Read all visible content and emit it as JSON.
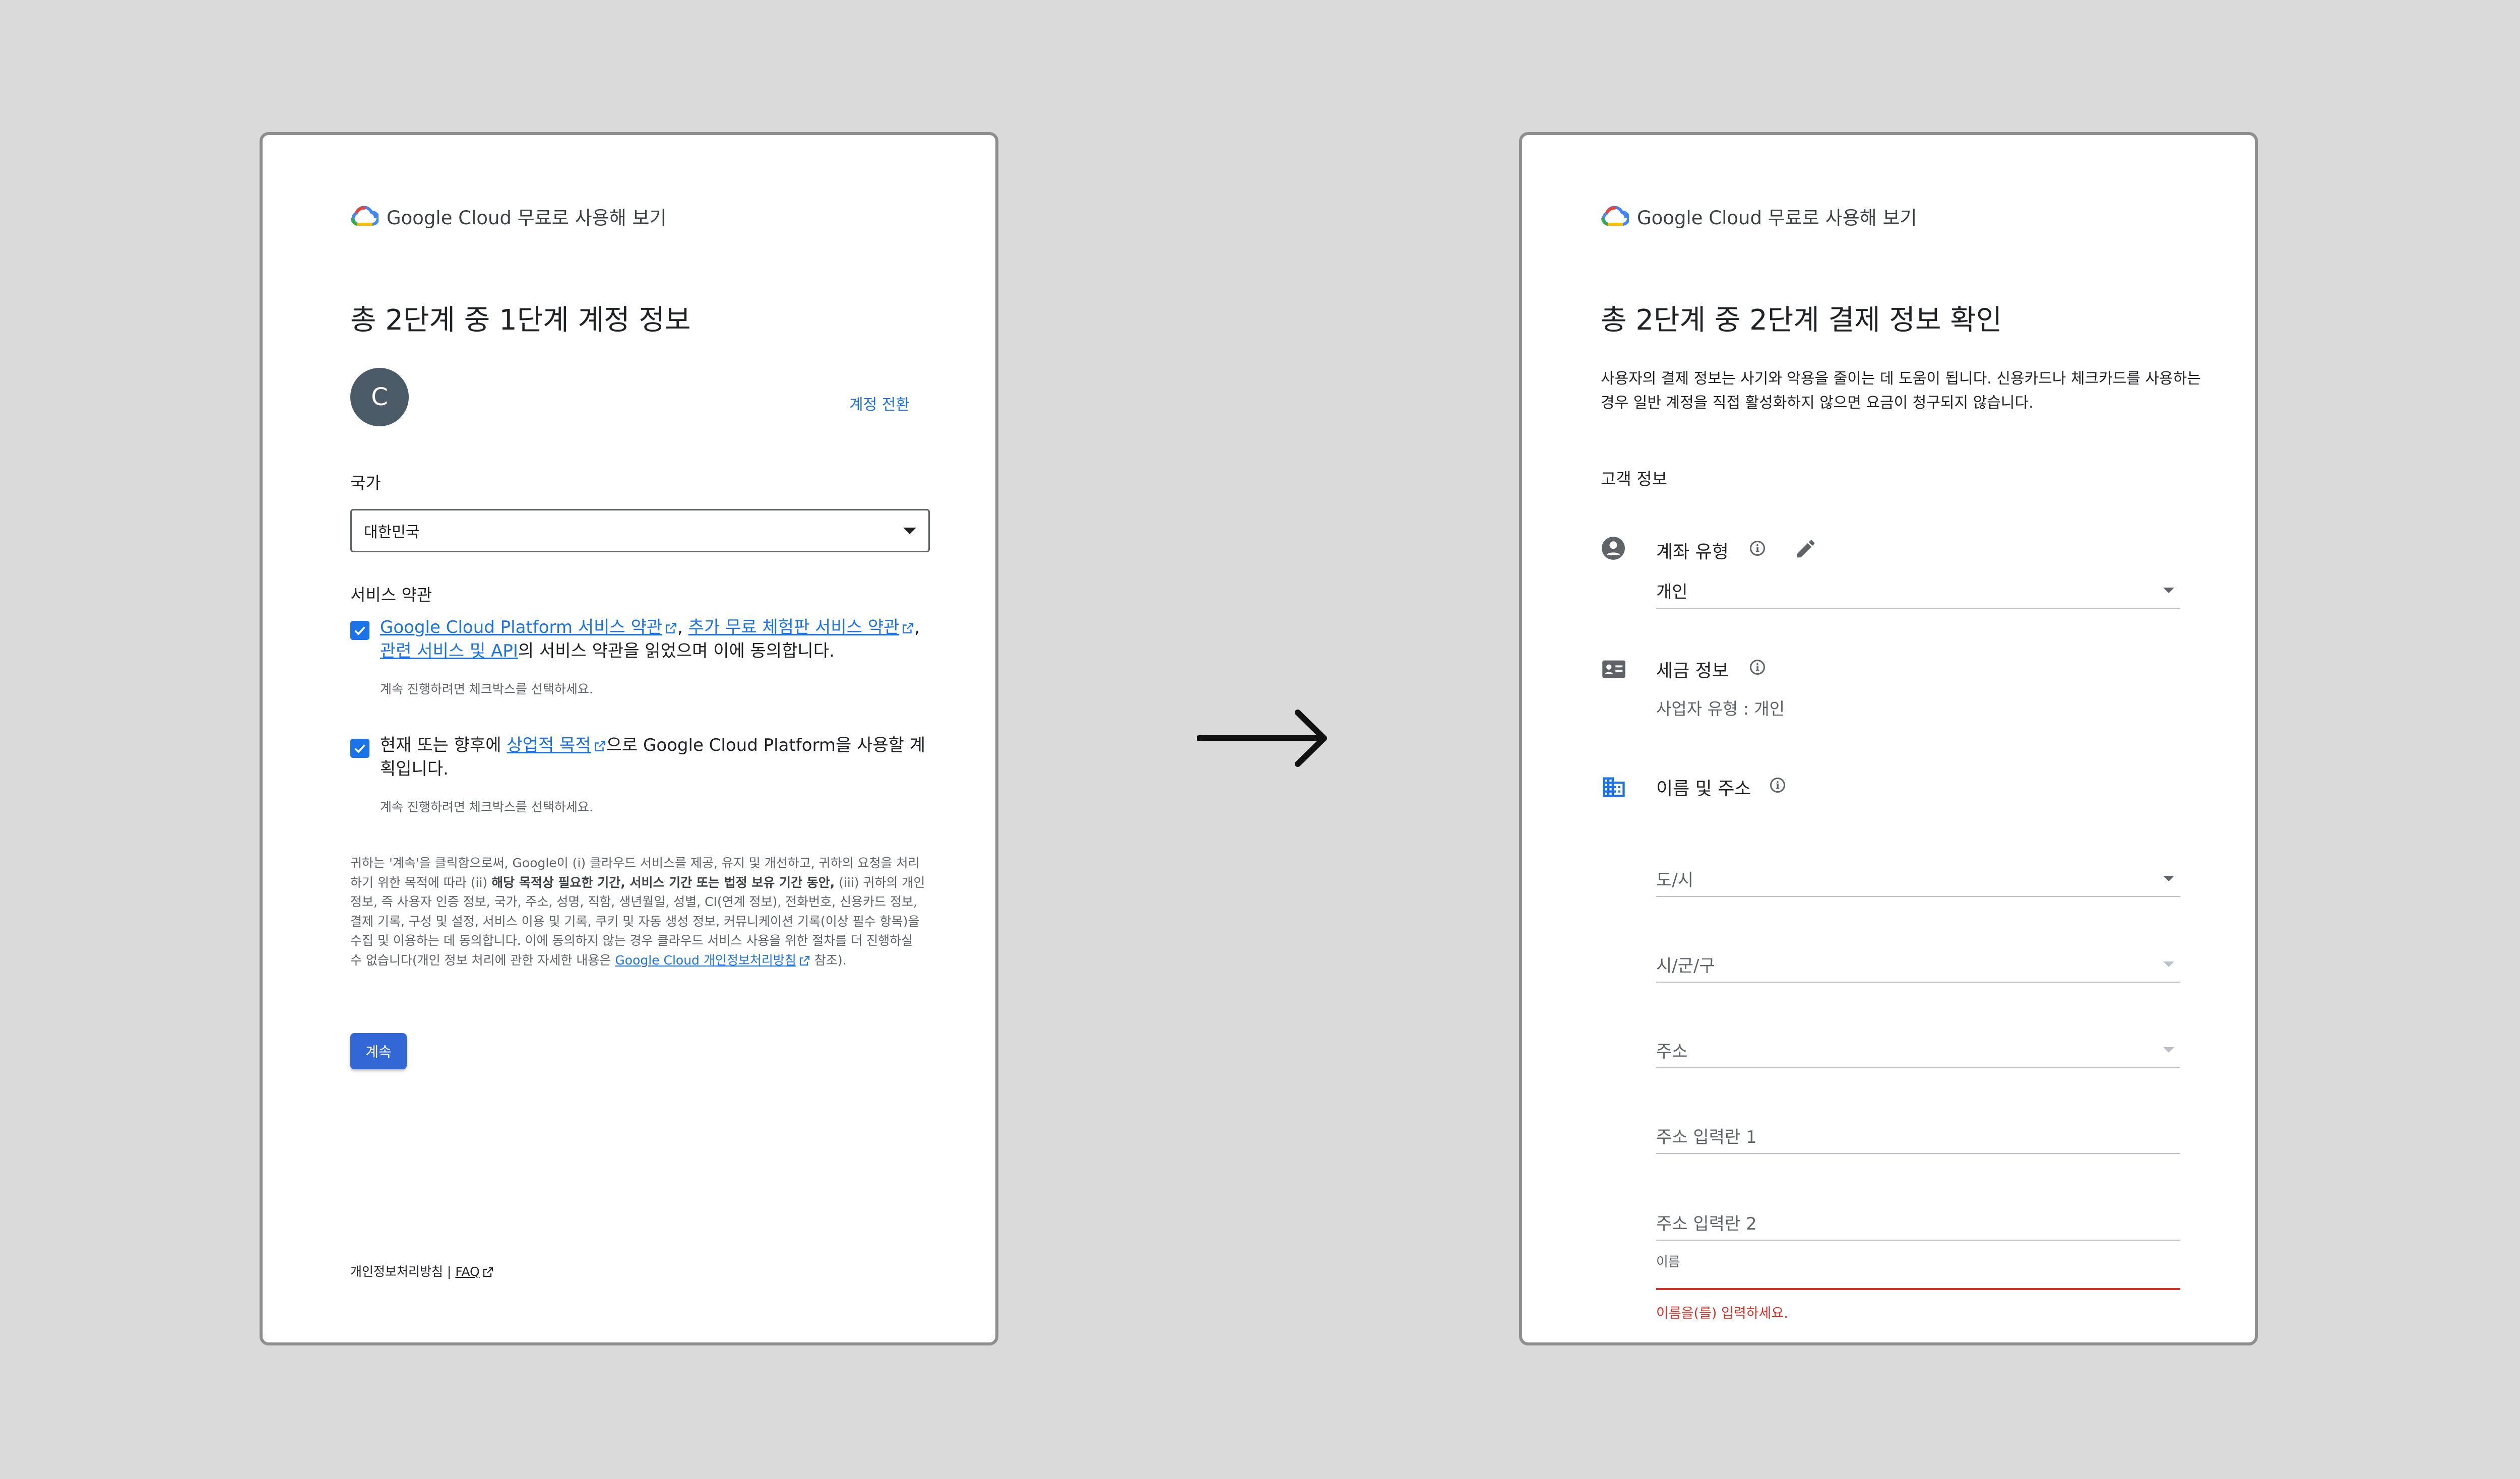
{
  "left": {
    "brand": "Google Cloud 무료로 사용해 보기",
    "step_title": "총 2단계 중 1단계 계정 정보",
    "avatar_initial": "C",
    "switch_account": "계정 전환",
    "country_label": "국가",
    "country_value": "대한민국",
    "terms_heading": "서비스 약관",
    "terms1_link_a": "Google Cloud Platform 서비스 약관",
    "terms1_sep1": ",",
    "terms1_link_b": "추가 무료 체험판 서비스 약관",
    "terms1_sep2": ",",
    "terms1_link_c": "관련 서비스 및 API",
    "terms1_suffix": "의 서비스 약관을 읽었으며 이에 동의합니다.",
    "terms1_checked": true,
    "terms1_hint": "계속 진행하려면 체크박스를 선택하세요.",
    "terms2_prefix": "현재 또는 향후에",
    "terms2_link": "상업적 목적",
    "terms2_suffix": "으로 Google Cloud Platform을 사용할 계획입니다.",
    "terms2_checked": true,
    "terms2_hint": "계속 진행하려면 체크박스를 선택하세요.",
    "legal_part1": "귀하는 '계속'을 클릭함으로써, Google이 (i) 클라우드 서비스를 제공, 유지 및 개선하고, 귀하의 요청을 처리하기 위한 목적에 따라 (ii)",
    "legal_bold": "해당 목적상 필요한 기간, 서비스 기간 또는 법정 보유 기간 동안,",
    "legal_part2": "(iii) 귀하의 개인 정보, 즉 사용자 인증 정보, 국가, 주소, 성명, 직함, 생년월일, 성별, CI(연계 정보), 전화번호, 신용카드 정보, 결제 기록, 구성 및 설정, 서비스 이용 및 기록, 쿠키 및 자동 생성 정보, 커뮤니케이션 기록(이상 필수 항목)을 수집 및 이용하는 데 동의합니다. 이에 동의하지 않는 경우 클라우드 서비스 사용을 위한 절차를 더 진행하실 수 없습니다(개인 정보 처리에 관한 자세한 내용은",
    "legal_link": "Google Cloud 개인정보처리방침",
    "legal_end": "참조).",
    "continue_button": "계속",
    "footer_privacy": "개인정보처리방침",
    "footer_sep": "|",
    "footer_faq": "FAQ"
  },
  "arrow": "→",
  "right": {
    "brand": "Google Cloud 무료로 사용해 보기",
    "step_title": "총 2단계 중 2단계 결제 정보 확인",
    "desc_line1": "사용자의 결제 정보는 사기와 악용을 줄이는 데 도움이 됩니다. 신용카드나 체크카드를 사용하는",
    "desc_line2": "경우 일반 계정을 직접 활성화하지 않으면 요금이 청구되지 않습니다.",
    "customer_info": "고객 정보",
    "account_type_label": "계좌 유형",
    "account_type_value": "개인",
    "tax_info_label": "세금 정보",
    "tax_info_value": "사업자 유형 : 개인",
    "name_address_label": "이름 및 주소",
    "city_placeholder": "도/시",
    "district_placeholder": "시/군/구",
    "address_placeholder": "주소",
    "address1_placeholder": "주소 입력란 1",
    "address2_placeholder": "주소 입력란 2",
    "name_label": "이름",
    "name_error": "이름을(를) 입력하세요.",
    "colors": {
      "error": "#d93025",
      "link": "#1a73e8"
    }
  },
  "colors": {
    "primary_button": "#3367d6",
    "avatar": "#4a5a66",
    "backdrop": "#dadada"
  }
}
